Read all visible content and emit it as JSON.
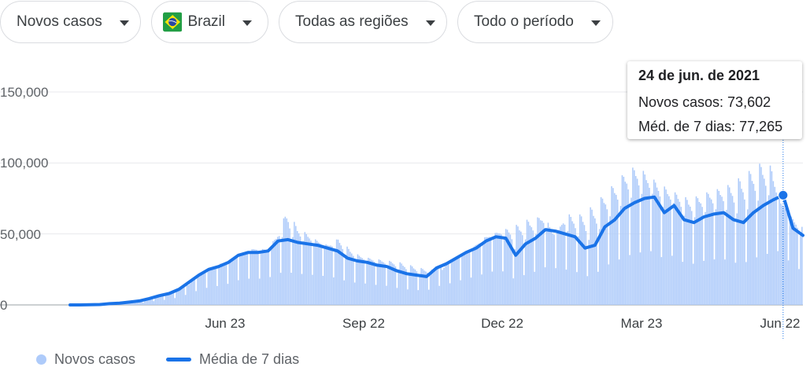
{
  "filters": {
    "metric": "Novos casos",
    "country": "Brazil",
    "region": "Todas as regiões",
    "period": "Todo o período"
  },
  "colors": {
    "bars": "#aecbfa",
    "line": "#1a73e8",
    "gridline": "#e8eaed"
  },
  "tooltip": {
    "date": "24 de jun. de 2021",
    "cases_label": "Novos casos: 73,602",
    "avg_label": "Méd. de 7 dias: 77,265"
  },
  "legend": {
    "bars_label": "Novos casos",
    "line_label": "Média de 7 dias"
  },
  "chart_data": {
    "type": "bar",
    "title": "",
    "xlabel": "",
    "ylabel": "",
    "ylim": [
      0,
      150000
    ],
    "y_ticks": [
      "0",
      "50,000",
      "100,000",
      "150,000"
    ],
    "x_ticks": [
      "Jun 23",
      "Sep 22",
      "Dec 22",
      "Mar 23",
      "Jun 22"
    ],
    "grid": true,
    "legend_position": "bottom-left",
    "x_start": "2020-02-26",
    "series": [
      {
        "name": "Novos casos",
        "type": "bar",
        "weekly_peak_values": [
          0,
          0,
          100,
          300,
          1000,
          1500,
          2500,
          3200,
          5500,
          7500,
          8000,
          11500,
          17000,
          23000,
          28000,
          30000,
          33000,
          38000,
          40000,
          39000,
          48000,
          67000,
          55000,
          50000,
          45000,
          42000,
          47000,
          40000,
          35000,
          33000,
          32000,
          31000,
          30000,
          28000,
          26000,
          25000,
          24000,
          32000,
          35000,
          40000,
          47000,
          50000,
          53000,
          55000,
          60000,
          60000,
          65000,
          45000,
          65000,
          62000,
          66000,
          72000,
          80000,
          87000,
          95000,
          98000,
          92000,
          86000,
          82000,
          78000,
          75000,
          77000,
          80000,
          82000,
          85000,
          90000,
          95000,
          100000,
          98000,
          70000,
          62000,
          55000
        ]
      },
      {
        "name": "Média de 7 dias",
        "type": "line",
        "weekly_values": [
          0,
          0,
          100,
          300,
          900,
          1300,
          2000,
          2800,
          4500,
          6500,
          8000,
          11000,
          16000,
          21000,
          25000,
          27000,
          30000,
          35000,
          37000,
          37000,
          38000,
          45000,
          46000,
          44000,
          43000,
          42000,
          40000,
          38000,
          33000,
          31000,
          30000,
          28000,
          27000,
          24000,
          22000,
          21000,
          20000,
          26000,
          29000,
          33000,
          37000,
          40000,
          45000,
          48000,
          47000,
          35000,
          43000,
          47000,
          53000,
          52000,
          50000,
          48000,
          40000,
          42000,
          55000,
          60000,
          68000,
          72000,
          75000,
          76000,
          65000,
          70000,
          60000,
          58000,
          62000,
          64000,
          65000,
          60000,
          58000,
          65000,
          70000,
          74000,
          77265,
          54000,
          49000
        ]
      }
    ],
    "highlight": {
      "date": "24 de jun. de 2021",
      "new_cases": 73602,
      "avg_7d": 77265
    }
  }
}
